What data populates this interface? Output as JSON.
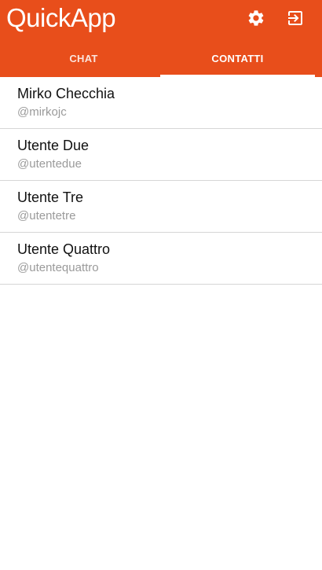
{
  "app": {
    "title": "QuickApp",
    "accent_color": "#e84e1b"
  },
  "toolbar": {
    "settings_icon": "gear-icon",
    "logout_icon": "logout-icon"
  },
  "tabs": [
    {
      "label": "CHAT",
      "selected": false
    },
    {
      "label": "CONTATTI",
      "selected": true
    }
  ],
  "contacts": [
    {
      "name": "Mirko Checchia",
      "username": "@mirkojc"
    },
    {
      "name": "Utente Due",
      "username": "@utentedue"
    },
    {
      "name": "Utente Tre",
      "username": "@utentetre"
    },
    {
      "name": "Utente Quattro",
      "username": "@utentequattro"
    }
  ]
}
